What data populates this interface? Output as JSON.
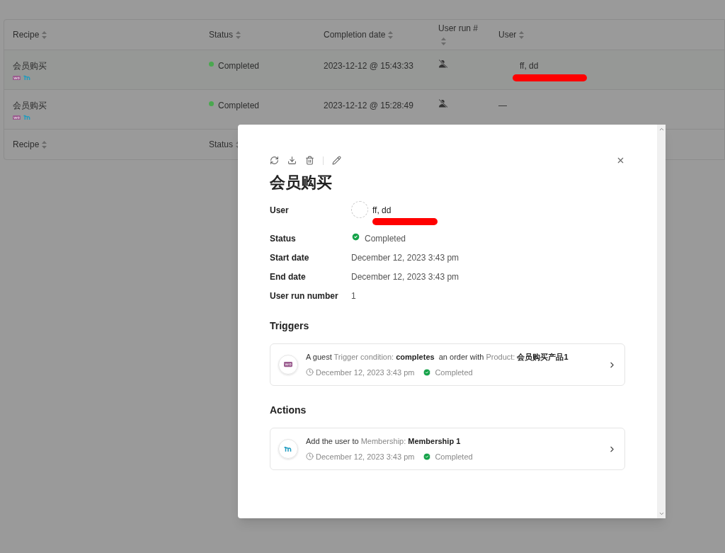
{
  "table": {
    "columns": [
      {
        "label": "Recipe"
      },
      {
        "label": "Status"
      },
      {
        "label": "Completion date"
      },
      {
        "label": "User run #"
      },
      {
        "label": "User"
      }
    ],
    "rows": [
      {
        "recipe": "会员购买",
        "status": "Completed",
        "color": "#4aa84f",
        "completion": "2023-12-12 @ 15:43:33",
        "user": "ff, dd",
        "redacted": true
      },
      {
        "recipe": "会员购买",
        "status": "Completed",
        "color": "#4aa84f",
        "completion": "2023-12-12 @ 15:28:49",
        "user": "—",
        "redacted": false
      }
    ],
    "footer_columns": [
      {
        "label": "Recipe"
      },
      {
        "label": "Status"
      }
    ]
  },
  "modal": {
    "title": "会员购买",
    "details": [
      {
        "kind": "user",
        "label": "User",
        "value": "ff, dd",
        "redacted": true
      },
      {
        "kind": "status",
        "label": "Status",
        "value": "Completed"
      },
      {
        "kind": "text",
        "label": "Start date",
        "value": "December 12, 2023 3:43 pm"
      },
      {
        "kind": "text",
        "label": "End date",
        "value": "December 12, 2023 3:43 pm"
      },
      {
        "kind": "text",
        "label": "User run number",
        "value": "1"
      }
    ],
    "sections": [
      {
        "title": "Triggers",
        "items": [
          {
            "kind": "woo",
            "parts": [
              {
                "kind": "plain",
                "text": "A guest "
              },
              {
                "kind": "label",
                "text": "Trigger condition: "
              },
              {
                "kind": "value",
                "text": "completes"
              },
              {
                "kind": "plain",
                "text": "  an order with "
              },
              {
                "kind": "label",
                "text": "Product: "
              },
              {
                "kind": "value",
                "text": "会员购买产品1"
              }
            ],
            "date": "December 12, 2023 3:43 pm",
            "status": "Completed"
          }
        ]
      },
      {
        "title": "Actions",
        "items": [
          {
            "kind": "membership",
            "parts": [
              {
                "kind": "plain",
                "text": "Add the user to "
              },
              {
                "kind": "label",
                "text": "Membership: "
              },
              {
                "kind": "value",
                "text": "Membership 1"
              }
            ],
            "date": "December 12, 2023 3:43 pm",
            "status": "Completed"
          }
        ]
      }
    ]
  }
}
